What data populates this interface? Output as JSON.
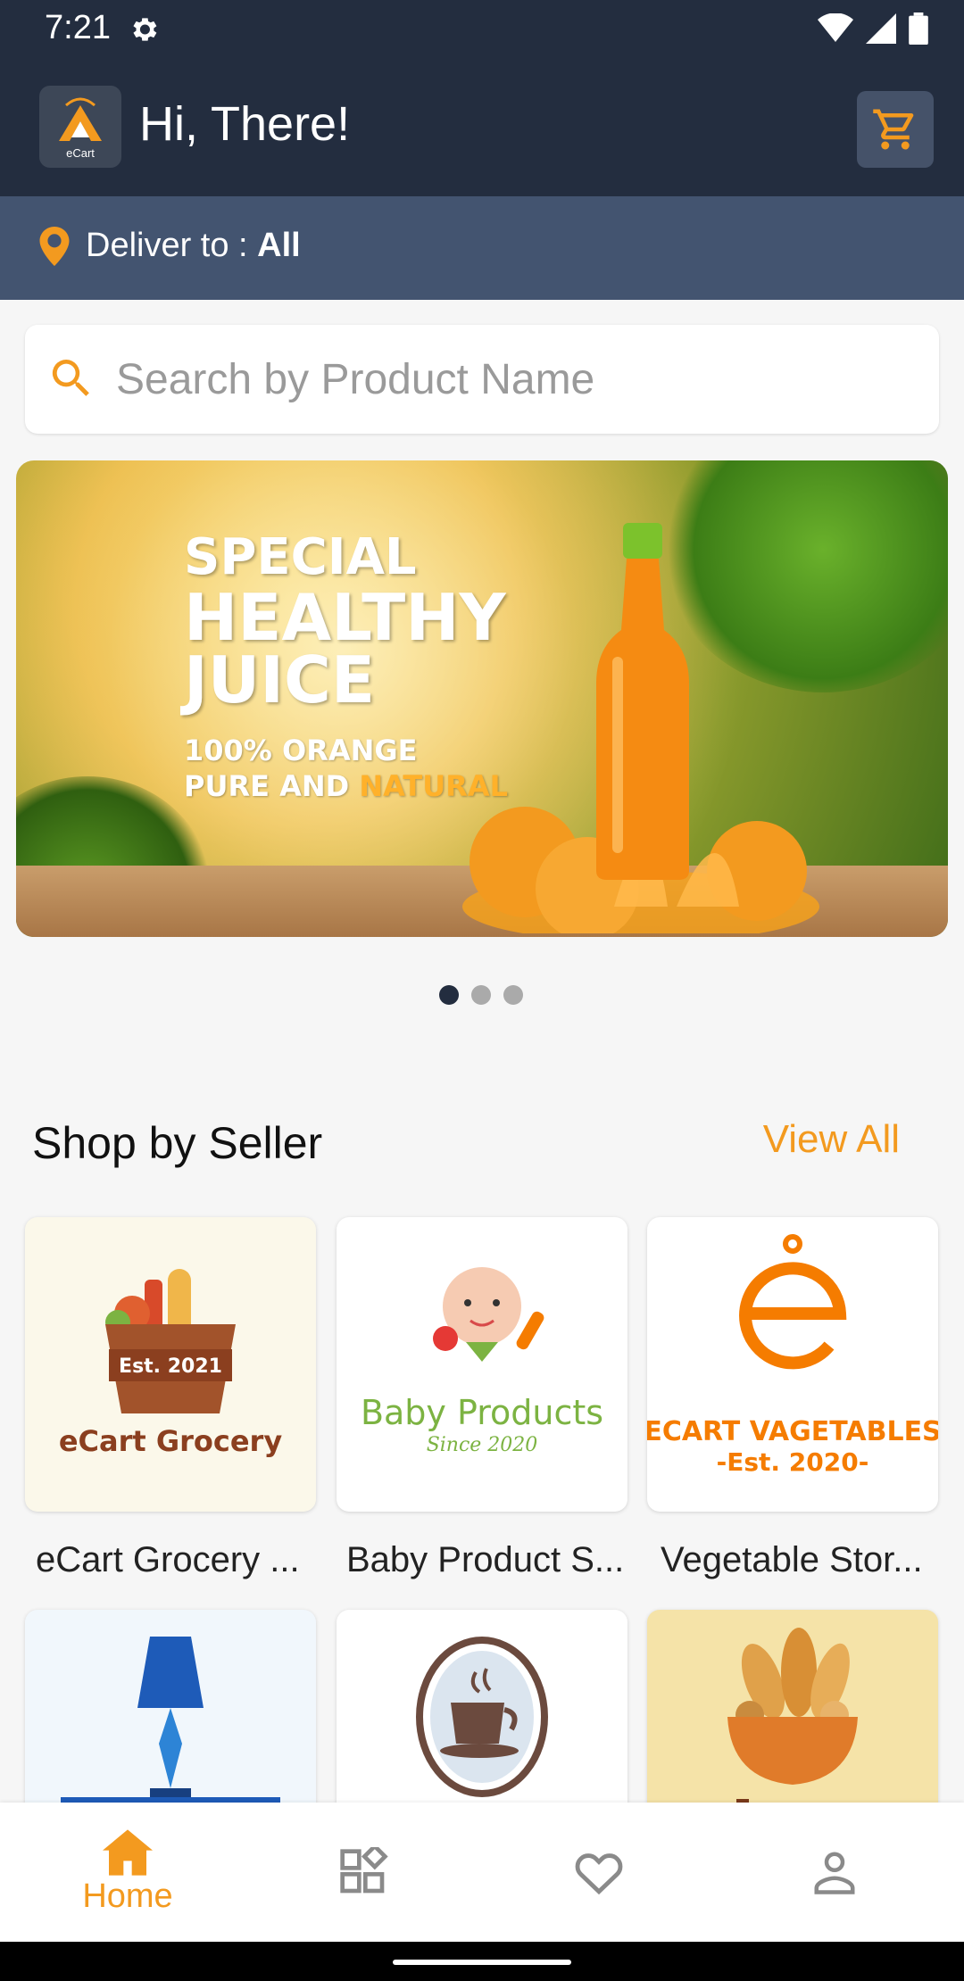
{
  "status_bar": {
    "time": "7:21"
  },
  "app_bar": {
    "greeting": "Hi, There!",
    "logo_text": "eCart"
  },
  "deliver": {
    "prefix": "Deliver to : ",
    "value": "All"
  },
  "search": {
    "placeholder": "Search by Product Name"
  },
  "banner": {
    "line1": "SPECIAL",
    "line2": "HEALTHY",
    "line3": "JUICE",
    "line4": "100% ORANGE",
    "line5_a": "PURE AND ",
    "line5_b": "NATURAL",
    "indicator_count": 3,
    "indicator_active": 1
  },
  "section": {
    "title": "Shop by Seller",
    "view_all": "View All"
  },
  "sellers": [
    {
      "name": "eCart  Grocery ...",
      "logo_text": "eCart Grocery",
      "logo_sub": "Est. 2021"
    },
    {
      "name": "Baby Product S...",
      "logo_text": "Baby Products",
      "logo_sub": "Since 2020"
    },
    {
      "name": "Vegetable Stor...",
      "logo_text": "ECART VAGETABLES",
      "logo_sub": "-Est. 2020-"
    }
  ],
  "bottom_nav": {
    "home": "Home"
  },
  "colors": {
    "accent": "#f39a1f",
    "dark": "#232d3f",
    "deliver_bar": "#435470"
  }
}
